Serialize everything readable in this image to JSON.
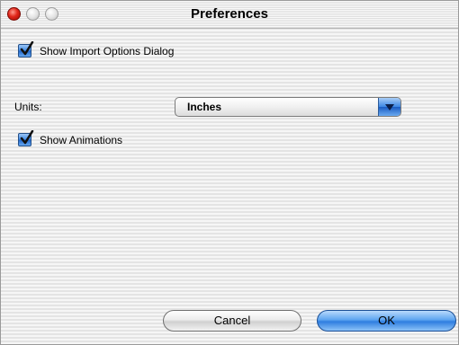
{
  "window": {
    "title": "Preferences"
  },
  "options": {
    "show_import_dialog": {
      "label": "Show Import Options Dialog",
      "checked": true
    },
    "units": {
      "label": "Units:",
      "value": "Inches"
    },
    "show_animations": {
      "label": "Show Animations",
      "checked": true
    }
  },
  "buttons": {
    "cancel": "Cancel",
    "ok": "OK"
  },
  "colors": {
    "accent": "#3d8ae6",
    "close": "#e0261a"
  },
  "icons": {
    "checkmark": "checkmark-icon",
    "dropdown": "chevron-down-icon"
  }
}
